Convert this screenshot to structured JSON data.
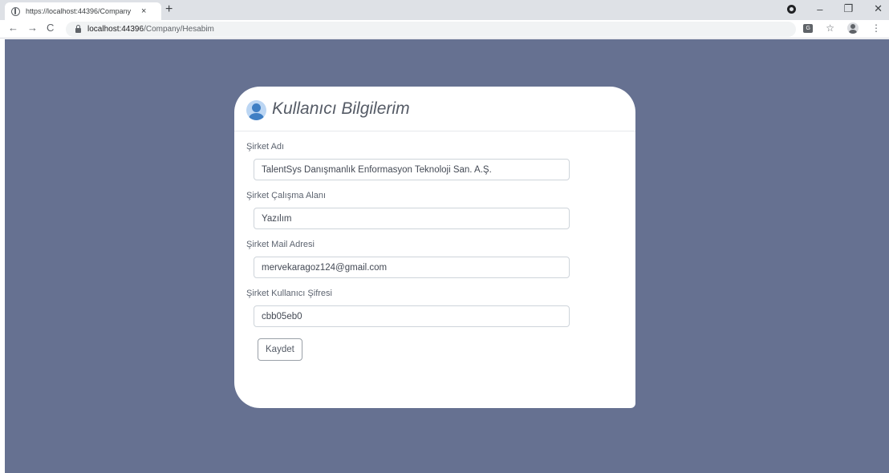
{
  "browser": {
    "tab_title": "https://localhost:44396/Company",
    "tab_close": "×",
    "new_tab": "+",
    "url_host": "localhost:44396",
    "url_path": "/Company/Hesabim",
    "back": "←",
    "forward": "→",
    "reload": "C",
    "star": "☆",
    "menu": "⋮",
    "minimize": "–",
    "restore": "❐",
    "close": "✕"
  },
  "card": {
    "title": "Kullanıcı Bilgilerim"
  },
  "form": {
    "fields": [
      {
        "label": "Şirket Adı",
        "value": "TalentSys Danışmanlık Enformasyon Teknoloji San. A.Ş."
      },
      {
        "label": "Şirket Çalışma Alanı",
        "value": "Yazılım"
      },
      {
        "label": "Şirket Mail Adresi",
        "value": "mervekaragoz124@gmail.com"
      },
      {
        "label": "Şirket Kullanıcı Şifresi",
        "value": "cbb05eb0"
      }
    ],
    "save_label": "Kaydet"
  },
  "colors": {
    "page_background": "#667191",
    "card_background": "#ffffff",
    "icon_accent": "#3f7fc4"
  },
  "icons": {
    "favicon": "globe-icon",
    "lock": "lock-icon",
    "user": "user-circle-icon",
    "translate": "translate-icon",
    "profile": "profile-icon",
    "record": "record-icon"
  }
}
